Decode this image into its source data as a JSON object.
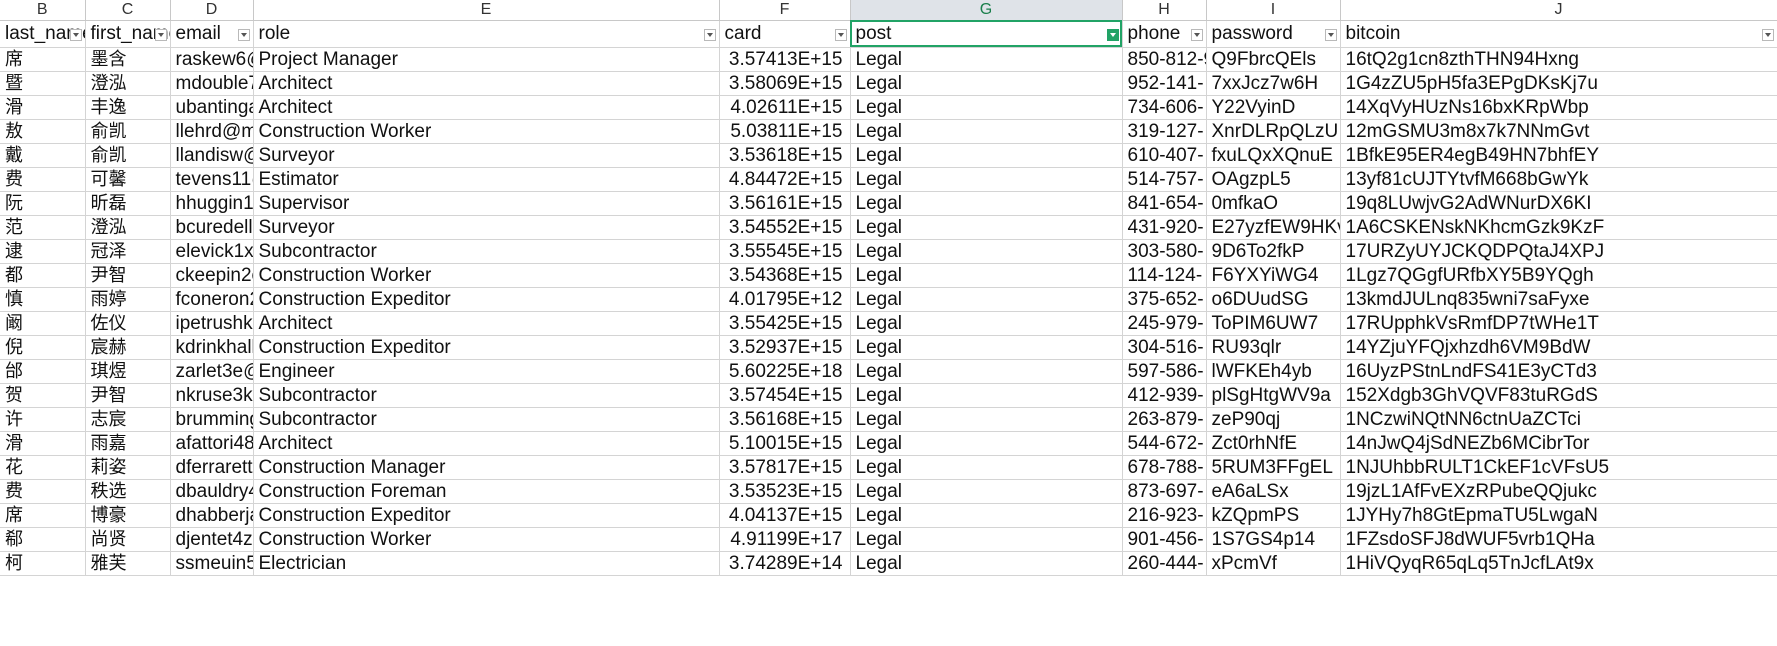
{
  "column_letters": [
    "B",
    "C",
    "D",
    "E",
    "F",
    "G",
    "H",
    "I",
    "J"
  ],
  "selected_column": "G",
  "headers": {
    "last_name": "last_name",
    "first_name": "first_name",
    "email": "email",
    "role": "role",
    "card": "card",
    "post": "post",
    "phone": "phone",
    "password": "password",
    "bitcoin": "bitcoin"
  },
  "rows": [
    {
      "last_name": "席",
      "first_name": "墨含",
      "email": "raskew6@",
      "role": "Project Manager",
      "card": "3.57413E+15",
      "post": "Legal",
      "phone": "850-812-9",
      "password": "Q9FbrcQEls",
      "bitcoin": "16tQ2g1cn8zthTHN94Hxng"
    },
    {
      "last_name": "暨",
      "first_name": "澄泓",
      "email": "mdouble7",
      "role": "Architect",
      "card": "3.58069E+15",
      "post": "Legal",
      "phone": "952-141-",
      "password": "7xxJcz7w6H",
      "bitcoin": "1G4zZU5pH5fa3EPgDKsKj7u"
    },
    {
      "last_name": "滑",
      "first_name": "丰逸",
      "email": "ubantinga",
      "role": "Architect",
      "card": "4.02611E+15",
      "post": "Legal",
      "phone": "734-606-",
      "password": "Y22VyinD",
      "bitcoin": "14XqVyHUzNs16bxKRpWbp"
    },
    {
      "last_name": "敖",
      "first_name": "俞凯",
      "email": "llehrd@m",
      "role": "Construction Worker",
      "card": "5.03811E+15",
      "post": "Legal",
      "phone": "319-127-",
      "password": "XnrDLRpQLzU",
      "bitcoin": "12mGSMU3m8x7k7NNmGvt"
    },
    {
      "last_name": "戴",
      "first_name": "俞凯",
      "email": "llandisw@",
      "role": "Surveyor",
      "card": "3.53618E+15",
      "post": "Legal",
      "phone": "610-407-",
      "password": "fxuLQxXQnuE",
      "bitcoin": "1BfkE95ER4egB49HN7bhfEY"
    },
    {
      "last_name": "费",
      "first_name": "可馨",
      "email": "tevens11@",
      "role": "Estimator",
      "card": "4.84472E+15",
      "post": "Legal",
      "phone": "514-757-",
      "password": "OAgzpL5",
      "bitcoin": "13yf81cUJTYtvfM668bGwYk"
    },
    {
      "last_name": "阮",
      "first_name": "昕磊",
      "email": "hhuggin1",
      "role": "Supervisor",
      "card": "3.56161E+15",
      "post": "Legal",
      "phone": "841-654-",
      "password": "0mfkaO",
      "bitcoin": "19q8LUwjvG2AdWNurDX6KI"
    },
    {
      "last_name": "范",
      "first_name": "澄泓",
      "email": "bcuredell",
      "role": "Surveyor",
      "card": "3.54552E+15",
      "post": "Legal",
      "phone": "431-920-",
      "password": "E27yzfEW9HKv",
      "bitcoin": "1A6CSKENskNKhcmGzk9KzF"
    },
    {
      "last_name": "逮",
      "first_name": "冠泽",
      "email": "elevick1x@",
      "role": "Subcontractor",
      "card": "3.55545E+15",
      "post": "Legal",
      "phone": "303-580-",
      "password": "9D6To2fkP",
      "bitcoin": "17URZyUYJCKQDPQtaJ4XPJ"
    },
    {
      "last_name": "都",
      "first_name": "尹智",
      "email": "ckeepin2c",
      "role": "Construction Worker",
      "card": "3.54368E+15",
      "post": "Legal",
      "phone": "114-124-",
      "password": "F6YXYiWG4",
      "bitcoin": "1Lgz7QGgfURfbXY5B9YQgh"
    },
    {
      "last_name": "慎",
      "first_name": "雨婷",
      "email": "fconeron2",
      "role": "Construction Expeditor",
      "card": "4.01795E+12",
      "post": "Legal",
      "phone": "375-652-",
      "password": "o6DUudSG",
      "bitcoin": "13kmdJULnq835wni7saFyxe"
    },
    {
      "last_name": "阚",
      "first_name": "佐仪",
      "email": "ipetrushka",
      "role": "Architect",
      "card": "3.55425E+15",
      "post": "Legal",
      "phone": "245-979-",
      "password": "ToPIM6UW7",
      "bitcoin": "17RUpphkVsRmfDP7tWHe1T"
    },
    {
      "last_name": "倪",
      "first_name": "宸赫",
      "email": "kdrinkhall",
      "role": "Construction Expeditor",
      "card": "3.52937E+15",
      "post": "Legal",
      "phone": "304-516-",
      "password": "RU93qlr",
      "bitcoin": "14YZjuYFQjxhzdh6VM9BdW"
    },
    {
      "last_name": "邰",
      "first_name": "琪煜",
      "email": "zarlet3e@",
      "role": "Engineer",
      "card": "5.60225E+18",
      "post": "Legal",
      "phone": "597-586-",
      "password": "lWFKEh4yb",
      "bitcoin": "16UyzPStnLndFS41E3yCTd3"
    },
    {
      "last_name": "贺",
      "first_name": "尹智",
      "email": "nkruse3k@",
      "role": "Subcontractor",
      "card": "3.57454E+15",
      "post": "Legal",
      "phone": "412-939-",
      "password": "plSgHtgWV9a",
      "bitcoin": "152Xdgb3GhVQVF83tuRGdS"
    },
    {
      "last_name": "许",
      "first_name": "志宸",
      "email": "brumming",
      "role": "Subcontractor",
      "card": "3.56168E+15",
      "post": "Legal",
      "phone": "263-879-",
      "password": "zeP90qj",
      "bitcoin": "1NCzwiNQtNN6ctnUaZCTci"
    },
    {
      "last_name": "滑",
      "first_name": "雨嘉",
      "email": "afattori48",
      "role": "Architect",
      "card": "5.10015E+15",
      "post": "Legal",
      "phone": "544-672-",
      "password": "Zct0rhNfE",
      "bitcoin": "14nJwQ4jSdNEZb6MCibrTor"
    },
    {
      "last_name": "花",
      "first_name": "莉姿",
      "email": "dferrarett",
      "role": "Construction Manager",
      "card": "3.57817E+15",
      "post": "Legal",
      "phone": "678-788-",
      "password": "5RUM3FFgEL",
      "bitcoin": "1NJUhbbRULT1CkEF1cVFsU5"
    },
    {
      "last_name": "费",
      "first_name": "秩选",
      "email": "dbauldry4",
      "role": "Construction Foreman",
      "card": "3.53523E+15",
      "post": "Legal",
      "phone": "873-697-",
      "password": "eA6aLSx",
      "bitcoin": "19jzL1AfFvEXzRPubeQQjukc"
    },
    {
      "last_name": "席",
      "first_name": "博豪",
      "email": "dhabberja",
      "role": "Construction Expeditor",
      "card": "4.04137E+15",
      "post": "Legal",
      "phone": "216-923-",
      "password": "kZQpmPS",
      "bitcoin": "1JYHy7h8GtEpmaTU5LwgaN"
    },
    {
      "last_name": "郗",
      "first_name": "尚贤",
      "email": "djentet4z",
      "role": "Construction Worker",
      "card": "4.91199E+17",
      "post": "Legal",
      "phone": "901-456-",
      "password": "1S7GS4p14",
      "bitcoin": "1FZsdoSFJ8dWUF5vrb1QHa"
    },
    {
      "last_name": "柯",
      "first_name": "雅芙",
      "email": "ssmeuin5",
      "role": "Electrician",
      "card": "3.74289E+14",
      "post": "Legal",
      "phone": "260-444-",
      "password": "xPcmVf",
      "bitcoin": "1HiVQyqR65qLq5TnJcfLAt9x"
    }
  ]
}
